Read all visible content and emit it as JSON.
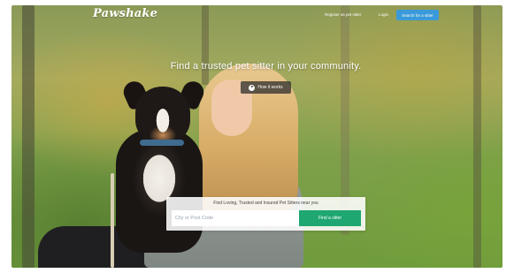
{
  "brand": {
    "logo_text": "Pawshake"
  },
  "nav": {
    "register_label": "Register as pet sitter",
    "login_label": "Login",
    "cta_label": "Search for a sitter"
  },
  "hero": {
    "headline": "Find a trusted pet sitter in your community.",
    "how_it_works_label": "How it works"
  },
  "search": {
    "caption": "Find Loving, Trusted and Insured Pet Sitters near you",
    "placeholder": "City or Post Code",
    "button_label": "Find a sitter"
  },
  "colors": {
    "cta_blue": "#3a9ad9",
    "find_green": "#1ea770"
  }
}
